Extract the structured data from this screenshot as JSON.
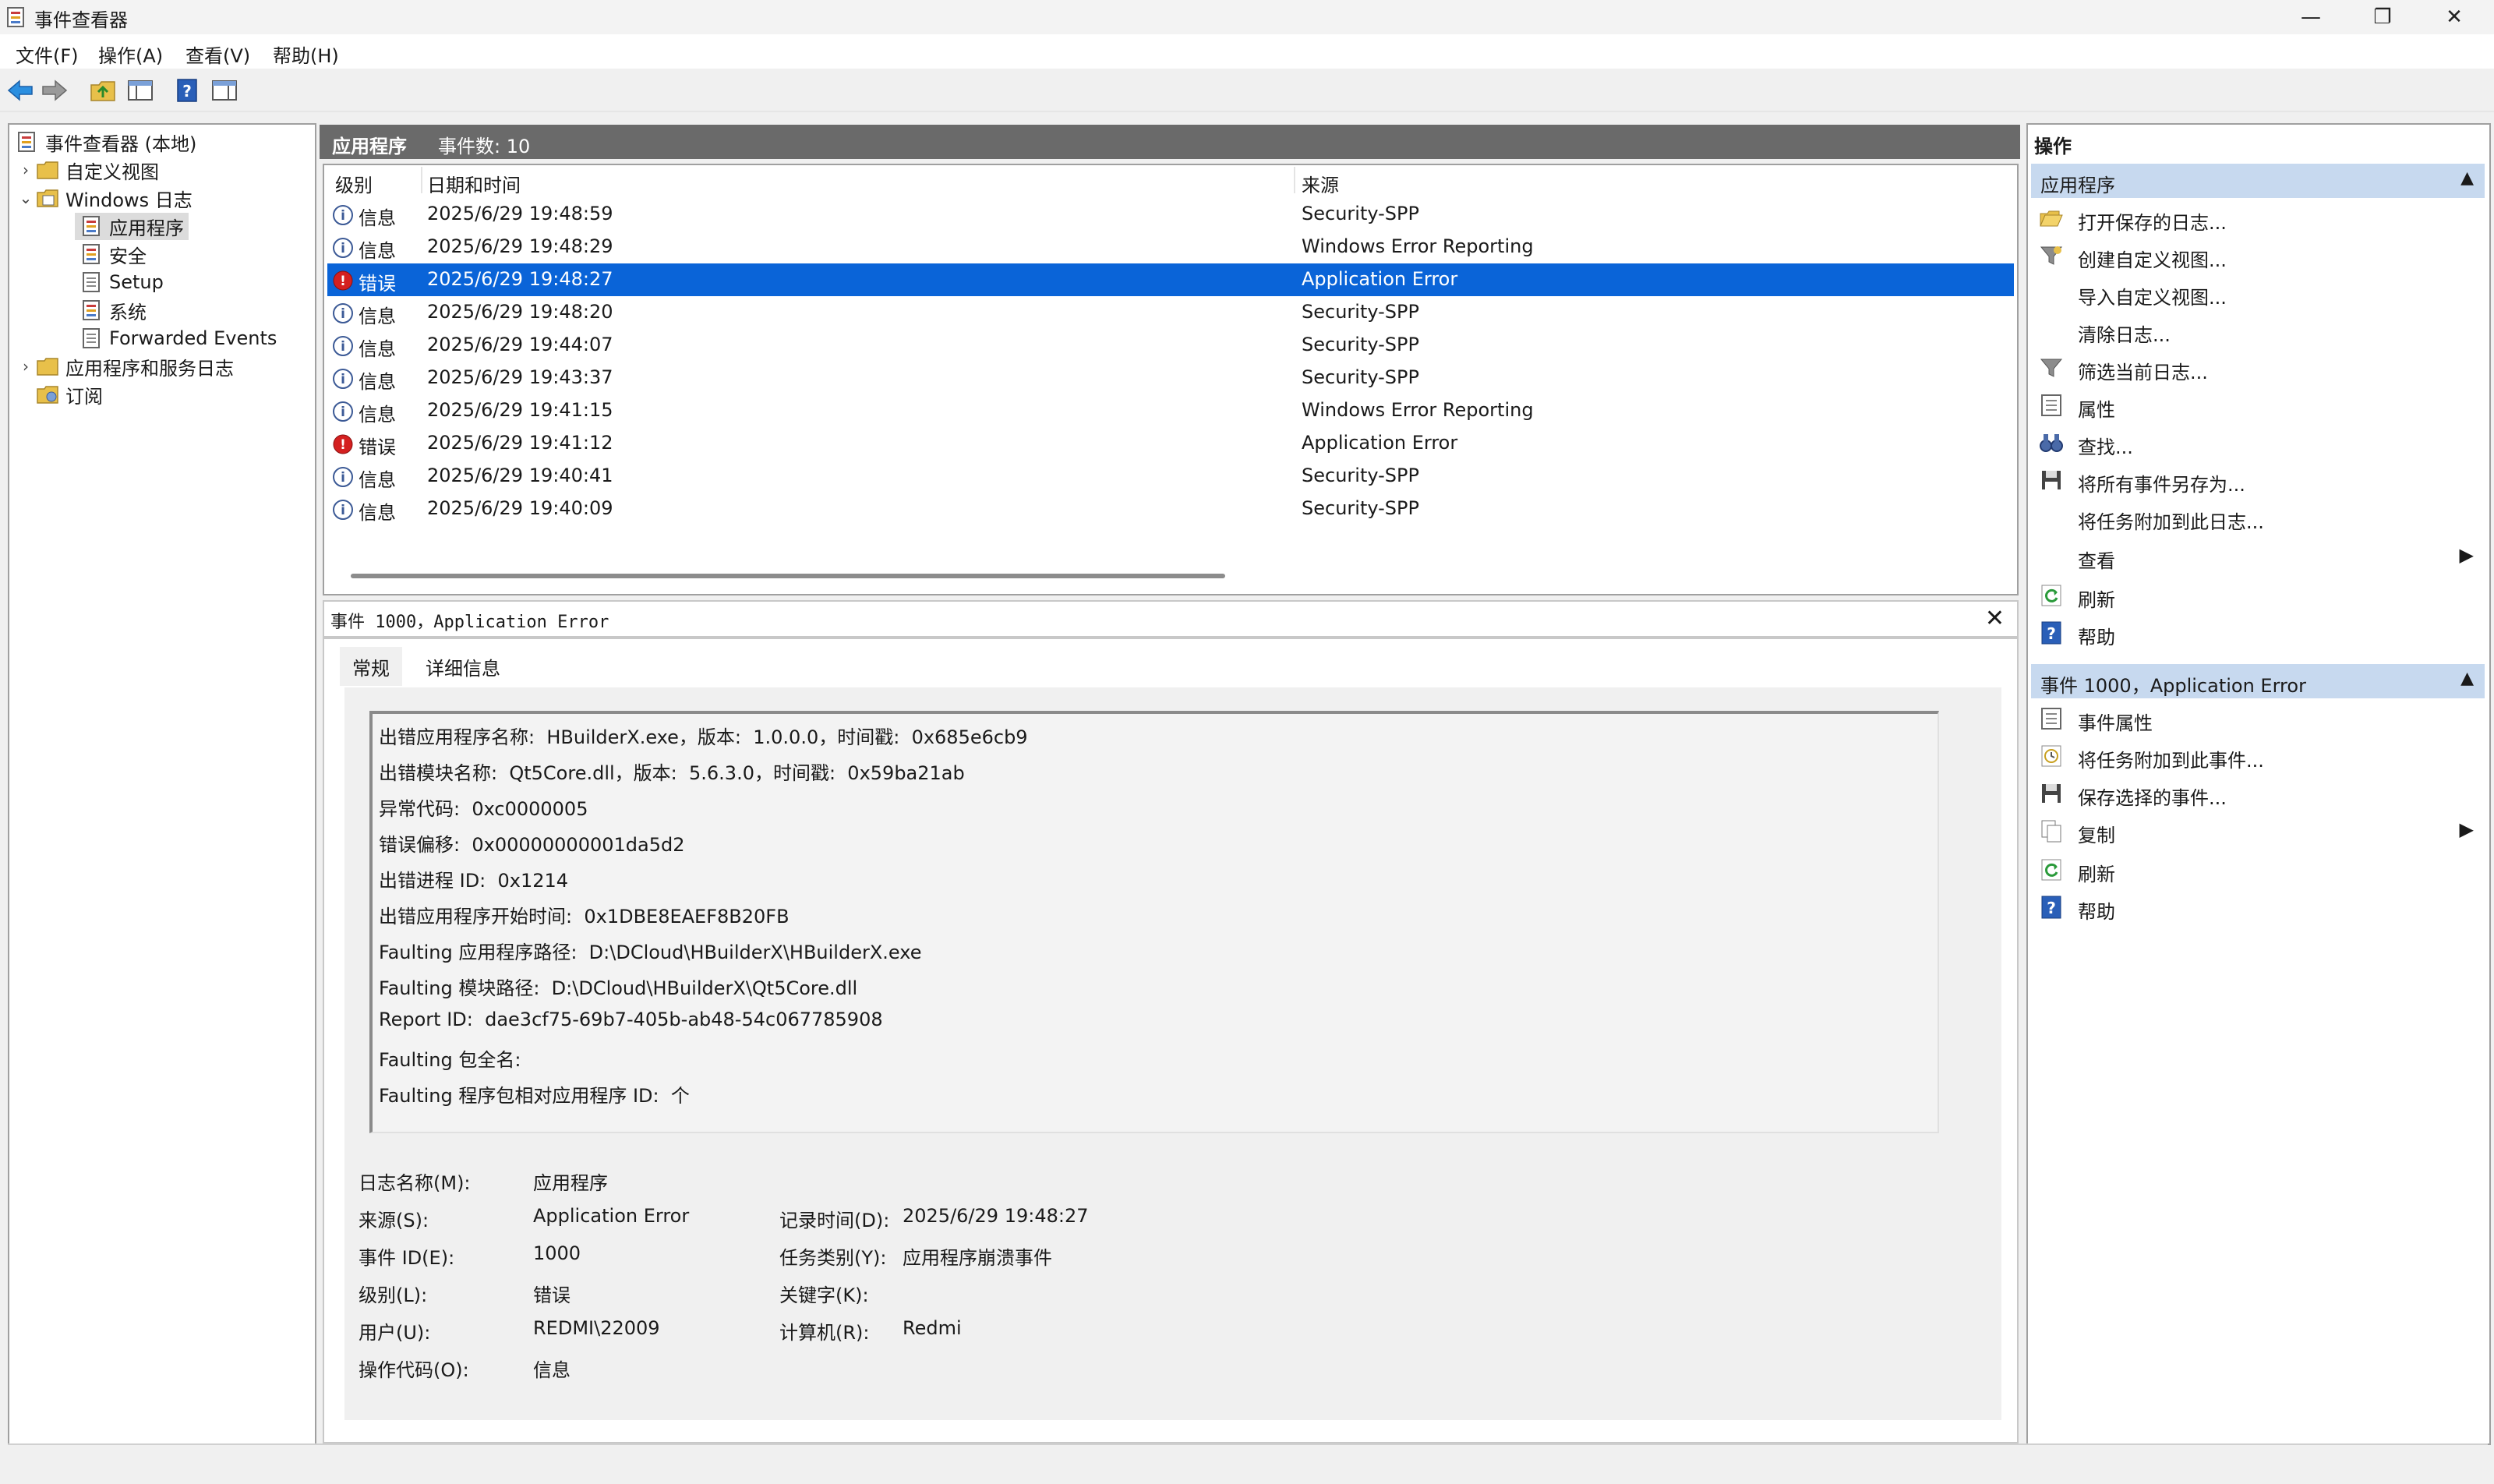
{
  "window": {
    "title": "事件查看器",
    "controls": {
      "minimize": "—",
      "maximize": "❐",
      "close": "✕"
    }
  },
  "menu": [
    "文件(F)",
    "操作(A)",
    "查看(V)",
    "帮助(H)"
  ],
  "tree": {
    "root": "事件查看器 (本地)",
    "custom_views": "自定义视图",
    "windows_logs": "Windows 日志",
    "logs": [
      "应用程序",
      "安全",
      "Setup",
      "系统",
      "Forwarded Events"
    ],
    "app_service_logs": "应用程序和服务日志",
    "subscriptions": "订阅"
  },
  "list": {
    "log_name": "应用程序",
    "event_count": "事件数: 10",
    "columns": {
      "level": "级别",
      "datetime": "日期和时间",
      "source": "来源"
    },
    "rows": [
      {
        "level": "信息",
        "type": "info",
        "datetime": "2025/6/29 19:48:59",
        "source": "Security-SPP"
      },
      {
        "level": "信息",
        "type": "info",
        "datetime": "2025/6/29 19:48:29",
        "source": "Windows Error Reporting"
      },
      {
        "level": "错误",
        "type": "error",
        "datetime": "2025/6/29 19:48:27",
        "source": "Application Error",
        "selected": true
      },
      {
        "level": "信息",
        "type": "info",
        "datetime": "2025/6/29 19:48:20",
        "source": "Security-SPP"
      },
      {
        "level": "信息",
        "type": "info",
        "datetime": "2025/6/29 19:44:07",
        "source": "Security-SPP"
      },
      {
        "level": "信息",
        "type": "info",
        "datetime": "2025/6/29 19:43:37",
        "source": "Security-SPP"
      },
      {
        "level": "信息",
        "type": "info",
        "datetime": "2025/6/29 19:41:15",
        "source": "Windows Error Reporting"
      },
      {
        "level": "错误",
        "type": "error",
        "datetime": "2025/6/29 19:41:12",
        "source": "Application Error"
      },
      {
        "level": "信息",
        "type": "info",
        "datetime": "2025/6/29 19:40:41",
        "source": "Security-SPP"
      },
      {
        "level": "信息",
        "type": "info",
        "datetime": "2025/6/29 19:40:09",
        "source": "Security-SPP"
      }
    ]
  },
  "detail": {
    "header": "事件 1000，Application Error",
    "close": "✕",
    "tabs": {
      "general": "常规",
      "details": "详细信息"
    },
    "description": [
      "出错应用程序名称:  HBuilderX.exe，版本:  1.0.0.0，时间戳:  0x685e6cb9",
      "出错模块名称:  Qt5Core.dll，版本:  5.6.3.0，时间戳:  0x59ba21ab",
      "异常代码:  0xc0000005",
      "错误偏移:  0x00000000001da5d2",
      "出错进程 ID:  0x1214",
      "出错应用程序开始时间:  0x1DBE8EAEF8B20FB",
      "Faulting 应用程序路径:  D:\\DCloud\\HBuilderX\\HBuilderX.exe",
      "Faulting 模块路径:  D:\\DCloud\\HBuilderX\\Qt5Core.dll",
      "Report ID:  dae3cf75-69b7-405b-ab48-54c067785908",
      "Faulting 包全名:",
      "Faulting 程序包相对应用程序 ID:  个"
    ],
    "fields": {
      "log_name_label": "日志名称(M):",
      "log_name": "应用程序",
      "source_label": "来源(S):",
      "source": "Application Error",
      "logged_label": "记录时间(D):",
      "logged": "2025/6/29 19:48:27",
      "event_id_label": "事件 ID(E):",
      "event_id": "1000",
      "task_label": "任务类别(Y):",
      "task": "应用程序崩溃事件",
      "level_label": "级别(L):",
      "level": "错误",
      "keywords_label": "关键字(K):",
      "keywords": "",
      "user_label": "用户(U):",
      "user": "REDMI\\22009",
      "computer_label": "计算机(R):",
      "computer": "Redmi",
      "opcode_label": "操作代码(O):",
      "opcode": "信息"
    }
  },
  "actions": {
    "title": "操作",
    "section1": "应用程序",
    "items1": [
      "打开保存的日志...",
      "创建自定义视图...",
      "导入自定义视图...",
      "清除日志...",
      "筛选当前日志...",
      "属性",
      "查找...",
      "将所有事件另存为...",
      "将任务附加到此日志...",
      "查看",
      "刷新",
      "帮助"
    ],
    "section2": "事件 1000，Application Error",
    "items2": [
      "事件属性",
      "将任务附加到此事件...",
      "保存选择的事件...",
      "复制",
      "刷新",
      "帮助"
    ],
    "collapse_arrow": "▲",
    "submenu_arrow": "▶"
  },
  "colors": {
    "selection": "#0a64d8",
    "section_bg": "#c7d9ef",
    "header_bg": "#6a6a6a",
    "error_icon": "#d42020",
    "info_icon": "#3c5a96"
  }
}
